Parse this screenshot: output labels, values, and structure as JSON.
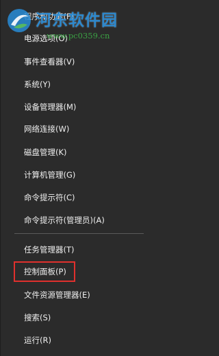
{
  "menu": {
    "items": [
      {
        "label": "程序和功能(F)"
      },
      {
        "label": "电源选项(O)"
      },
      {
        "label": "事件查看器(V)"
      },
      {
        "label": "系统(Y)"
      },
      {
        "label": "设备管理器(M)"
      },
      {
        "label": "网络连接(W)"
      },
      {
        "label": "磁盘管理(K)"
      },
      {
        "label": "计算机管理(G)"
      },
      {
        "label": "命令提示符(C)"
      },
      {
        "label": "命令提示符(管理员)(A)"
      },
      {
        "label": "任务管理器(T)"
      },
      {
        "label": "控制面板(P)"
      },
      {
        "label": "文件资源管理器(E)"
      },
      {
        "label": "搜索(S)"
      },
      {
        "label": "运行(R)"
      }
    ],
    "highlighted_item": "控制面板(P)"
  },
  "watermark": {
    "title": "河东软件园",
    "url": "www.pc0359.cn"
  },
  "colors": {
    "menu_background": "#2b2b2b",
    "text": "#f0f0f0",
    "separator": "#5a5a5a",
    "highlight_border": "#e0302d"
  }
}
